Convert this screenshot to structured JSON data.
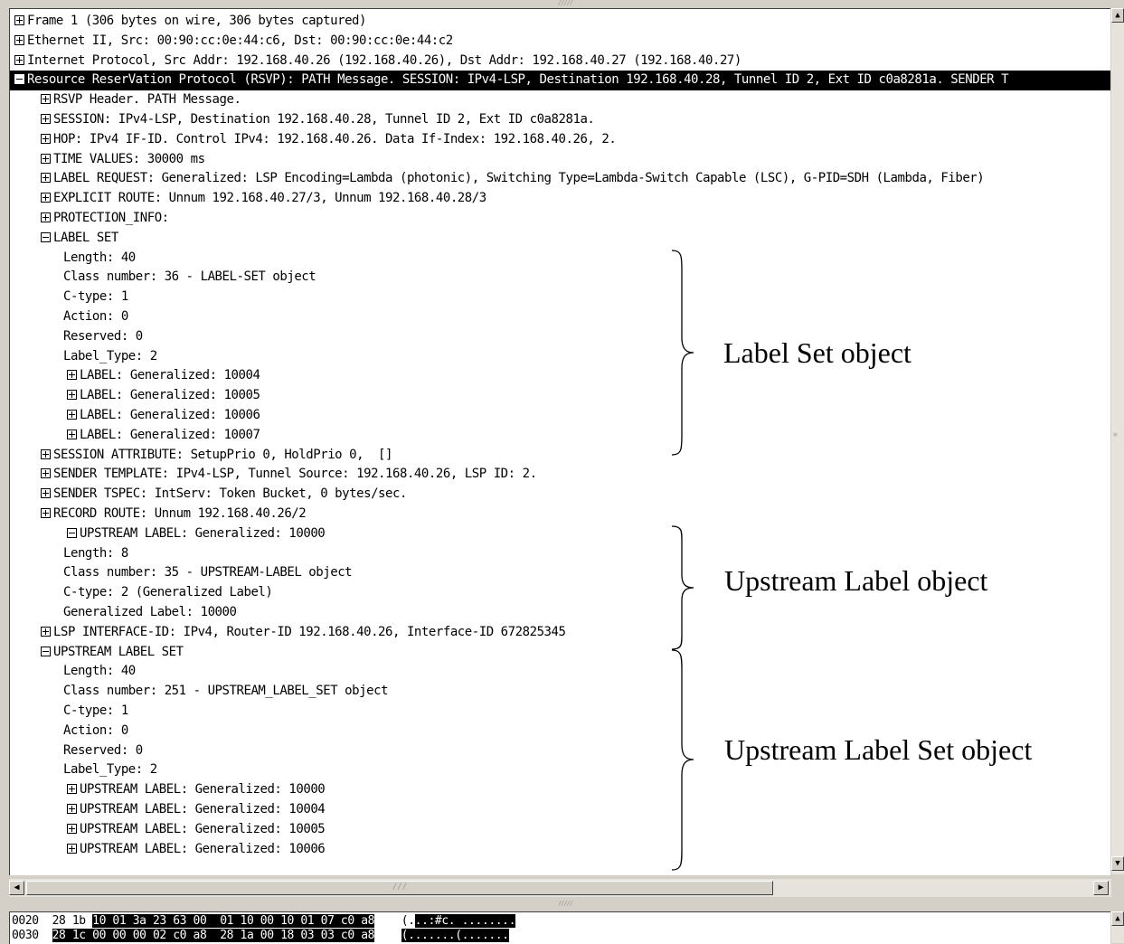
{
  "pane_grip": "/////",
  "packet_tree": {
    "rows": [
      {
        "expander": "plus",
        "text": "Frame 1 (306 bytes on wire, 306 bytes captured)"
      },
      {
        "expander": "plus",
        "text": "Ethernet II, Src: 00:90:cc:0e:44:c6, Dst: 00:90:cc:0e:44:c2"
      },
      {
        "expander": "plus",
        "text": "Internet Protocol, Src Addr: 192.168.40.26 (192.168.40.26), Dst Addr: 192.168.40.27 (192.168.40.27)"
      },
      {
        "expander": "minus",
        "text": "Resource ReserVation Protocol (RSVP): PATH Message. SESSION: IPv4-LSP, Destination 192.168.40.28, Tunnel ID 2, Ext ID c0a8281a. SENDER T",
        "selected": true
      },
      {
        "expander": "plus",
        "text": "RSVP Header. PATH Message."
      },
      {
        "expander": "plus",
        "text": "SESSION: IPv4-LSP, Destination 192.168.40.28, Tunnel ID 2, Ext ID c0a8281a."
      },
      {
        "expander": "plus",
        "text": "HOP: IPv4 IF-ID. Control IPv4: 192.168.40.26. Data If-Index: 192.168.40.26, 2."
      },
      {
        "expander": "plus",
        "text": "TIME VALUES: 30000 ms"
      },
      {
        "expander": "plus",
        "text": "LABEL REQUEST: Generalized: LSP Encoding=Lambda (photonic), Switching Type=Lambda-Switch Capable (LSC), G-PID=SDH (Lambda, Fiber)"
      },
      {
        "expander": "plus",
        "text": "EXPLICIT ROUTE: Unnum 192.168.40.27/3, Unnum 192.168.40.28/3"
      },
      {
        "expander": "plus",
        "text": "PROTECTION_INFO:"
      },
      {
        "expander": "minus",
        "text": "LABEL SET"
      },
      {
        "expander": "",
        "text": "Length: 40"
      },
      {
        "expander": "",
        "text": "Class number: 36 - LABEL-SET object"
      },
      {
        "expander": "",
        "text": "C-type: 1"
      },
      {
        "expander": "",
        "text": "Action: 0"
      },
      {
        "expander": "",
        "text": "Reserved: 0"
      },
      {
        "expander": "",
        "text": "Label_Type: 2"
      },
      {
        "expander": "plus",
        "text": "LABEL: Generalized: 10004"
      },
      {
        "expander": "plus",
        "text": "LABEL: Generalized: 10005"
      },
      {
        "expander": "plus",
        "text": "LABEL: Generalized: 10006"
      },
      {
        "expander": "plus",
        "text": "LABEL: Generalized: 10007"
      },
      {
        "expander": "plus",
        "text": "SESSION ATTRIBUTE: SetupPrio 0, HoldPrio 0,  []"
      },
      {
        "expander": "plus",
        "text": "SENDER TEMPLATE: IPv4-LSP, Tunnel Source: 192.168.40.26, LSP ID: 2."
      },
      {
        "expander": "plus",
        "text": "SENDER TSPEC: IntServ: Token Bucket, 0 bytes/sec."
      },
      {
        "expander": "plus",
        "text": "RECORD ROUTE: Unnum 192.168.40.26/2"
      },
      {
        "expander": "minus",
        "text": "UPSTREAM LABEL: Generalized: 10000"
      },
      {
        "expander": "",
        "text": "Length: 8"
      },
      {
        "expander": "",
        "text": "Class number: 35 - UPSTREAM-LABEL object"
      },
      {
        "expander": "",
        "text": "C-type: 2 (Generalized Label)"
      },
      {
        "expander": "",
        "text": "Generalized Label: 10000"
      },
      {
        "expander": "plus",
        "text": "LSP INTERFACE-ID: IPv4, Router-ID 192.168.40.26, Interface-ID 672825345"
      },
      {
        "expander": "minus",
        "text": "UPSTREAM LABEL SET"
      },
      {
        "expander": "",
        "text": "Length: 40"
      },
      {
        "expander": "",
        "text": "Class number: 251 - UPSTREAM_LABEL_SET object"
      },
      {
        "expander": "",
        "text": "C-type: 1"
      },
      {
        "expander": "",
        "text": "Action: 0"
      },
      {
        "expander": "",
        "text": "Reserved: 0"
      },
      {
        "expander": "",
        "text": "Label_Type: 2"
      },
      {
        "expander": "plus",
        "text": "UPSTREAM LABEL: Generalized: 10000"
      },
      {
        "expander": "plus",
        "text": "UPSTREAM LABEL: Generalized: 10004"
      },
      {
        "expander": "plus",
        "text": "UPSTREAM LABEL: Generalized: 10005"
      },
      {
        "expander": "plus",
        "text": "UPSTREAM LABEL: Generalized: 10006"
      }
    ]
  },
  "annotations": {
    "label_set": "Label Set object",
    "upstream_label": "Upstream Label object",
    "upstream_label_set": "Upstream Label Set object"
  },
  "hscroll_grip": "///",
  "hex_dump": {
    "rows": [
      {
        "offset": "0020",
        "hex_plain": "28 1b ",
        "hex_hl": "10 01 3a 23 63 00  01 10 00 10 01 07 c0 a8",
        "ascii_plain": "(.",
        "ascii_hl": "..:#c. ........"
      },
      {
        "offset": "0030",
        "hex_plain": "",
        "hex_hl": "28 1c 00 00 00 02 c0 a8  28 1a 00 18 03 03 c0 a8",
        "ascii_plain": "",
        "ascii_hl": "(.......(......."
      }
    ]
  },
  "icons": {
    "scroll_up": "scroll-up-arrow-icon",
    "scroll_down": "scroll-down-arrow-icon",
    "scroll_left": "scroll-left-arrow-icon",
    "scroll_right": "scroll-right-arrow-icon",
    "expand": "expand-plus-icon",
    "collapse": "collapse-minus-icon"
  },
  "colors": {
    "selection_bg": "#000000",
    "selection_fg": "#ffffff",
    "pane_bg": "#ffffff",
    "chrome_bg": "#d4d0c8"
  }
}
